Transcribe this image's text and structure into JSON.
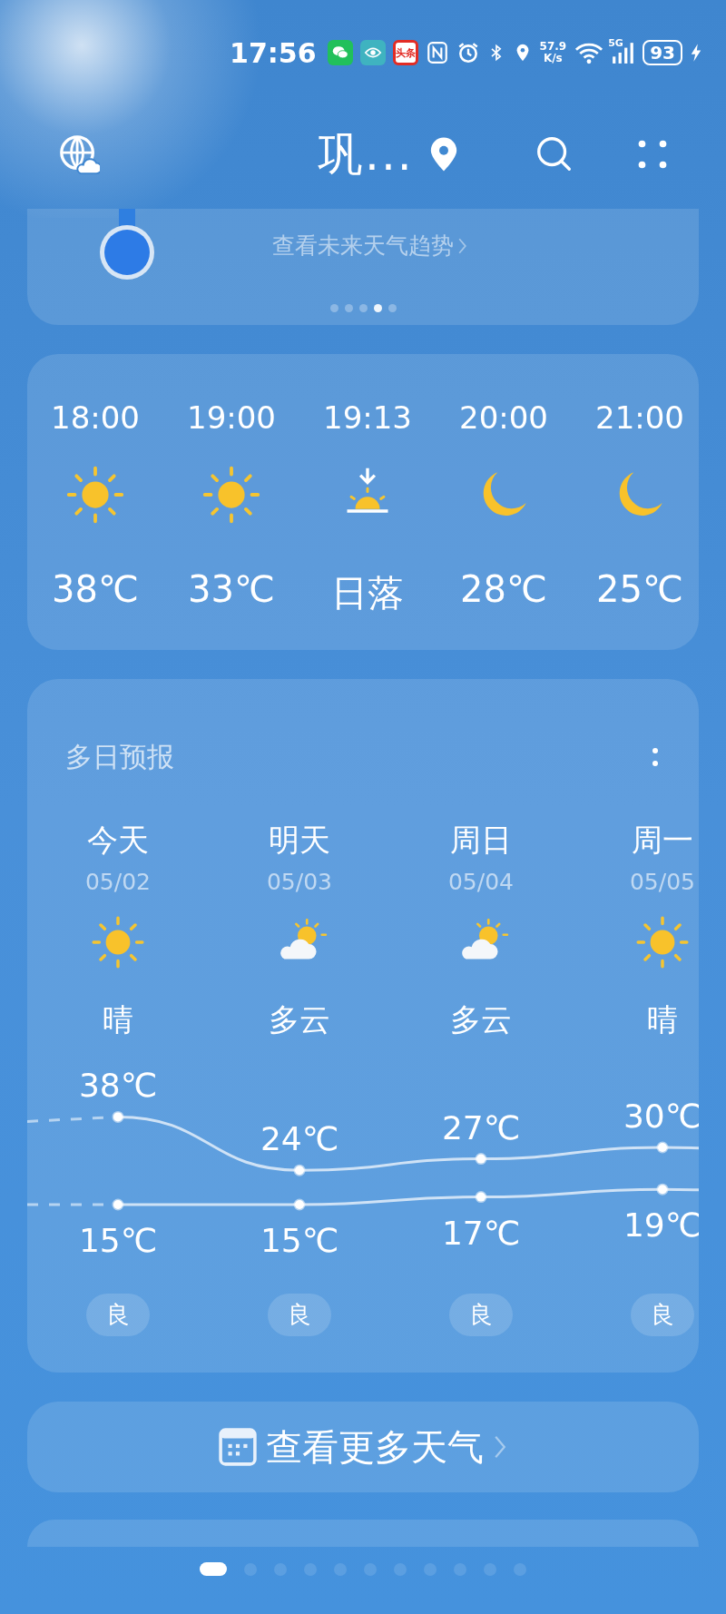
{
  "status_bar": {
    "time": "17:56",
    "app_label": "头条",
    "net_speed": "57.9",
    "net_unit": "K/s",
    "network": "5G",
    "battery": "93",
    "charging": true
  },
  "header": {
    "title": "巩..."
  },
  "tip_card": {
    "link": "查看未来天气趋势",
    "dots": [
      {
        "selected": false
      },
      {
        "selected": false
      },
      {
        "selected": false
      },
      {
        "selected": true
      },
      {
        "selected": false
      }
    ]
  },
  "hourly": [
    {
      "time": "18:00",
      "kind": "sun",
      "temp": "38℃"
    },
    {
      "time": "19:00",
      "kind": "sun",
      "temp": "33℃"
    },
    {
      "time": "19:13",
      "kind": "sunset",
      "temp": "日落"
    },
    {
      "time": "20:00",
      "kind": "moon",
      "temp": "28℃"
    },
    {
      "time": "21:00",
      "kind": "moon",
      "temp": "25℃"
    }
  ],
  "forecast": {
    "title": "多日预报",
    "days": [
      {
        "day": "今天",
        "date": "05/02",
        "kind": "sun",
        "condition": "晴",
        "high": "38℃",
        "low": "15℃",
        "aqi": "良"
      },
      {
        "day": "明天",
        "date": "05/03",
        "kind": "cloudy-sun",
        "condition": "多云",
        "high": "24℃",
        "low": "15℃",
        "aqi": "良"
      },
      {
        "day": "周日",
        "date": "05/04",
        "kind": "cloudy-sun",
        "condition": "多云",
        "high": "27℃",
        "low": "17℃",
        "aqi": "良"
      },
      {
        "day": "周一",
        "date": "05/05",
        "kind": "sun",
        "condition": "晴",
        "high": "30℃",
        "low": "19℃",
        "aqi": "良"
      }
    ]
  },
  "more_button": {
    "label": "查看更多天气"
  },
  "pager": [
    {
      "selected": true
    },
    {
      "selected": false
    },
    {
      "selected": false
    },
    {
      "selected": false
    },
    {
      "selected": false
    },
    {
      "selected": false
    },
    {
      "selected": false
    },
    {
      "selected": false
    },
    {
      "selected": false
    },
    {
      "selected": false
    },
    {
      "selected": false
    }
  ]
}
